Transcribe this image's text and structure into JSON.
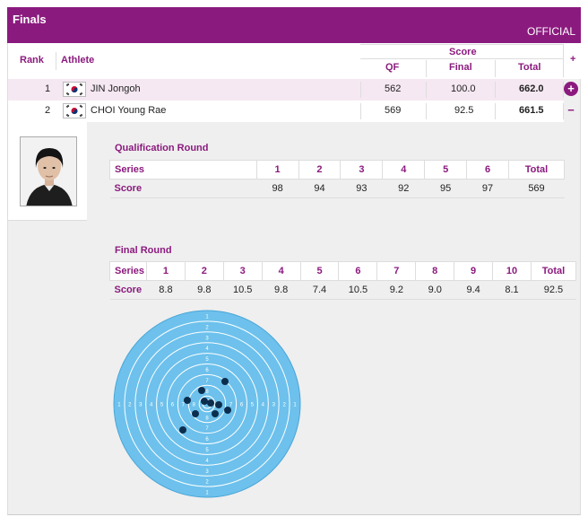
{
  "header": {
    "title": "Finals",
    "status": "OFFICIAL"
  },
  "columns": {
    "rank": "Rank",
    "athlete": "Athlete",
    "score_group": "Score",
    "qf": "QF",
    "final": "Final",
    "total": "Total",
    "expand_all": "+"
  },
  "rows": [
    {
      "rank": "1",
      "name": "JIN Jongoh",
      "qf": "562",
      "final": "100.0",
      "total": "662.0",
      "toggle": "+"
    },
    {
      "rank": "2",
      "name": "CHOI Young Rae",
      "qf": "569",
      "final": "92.5",
      "total": "661.5",
      "toggle": "−"
    }
  ],
  "qualification": {
    "title": "Qualification Round",
    "series_label": "Series",
    "score_label": "Score",
    "total_label": "Total",
    "series": [
      "1",
      "2",
      "3",
      "4",
      "5",
      "6"
    ],
    "scores": [
      "98",
      "94",
      "93",
      "92",
      "95",
      "97"
    ],
    "total": "569"
  },
  "final_round": {
    "title": "Final Round",
    "series_label": "Series",
    "score_label": "Score",
    "total_label": "Total",
    "series": [
      "1",
      "2",
      "3",
      "4",
      "5",
      "6",
      "7",
      "8",
      "9",
      "10"
    ],
    "scores": [
      "8.8",
      "9.8",
      "10.5",
      "9.8",
      "7.4",
      "10.5",
      "9.2",
      "9.0",
      "9.4",
      "8.1"
    ],
    "total": "92.5"
  },
  "target": {
    "ring_numbers": [
      "1",
      "2",
      "3",
      "4",
      "5",
      "6",
      "7",
      "8"
    ],
    "colors": {
      "ring": "#6dc1ec",
      "line": "#ffffff",
      "shot": "#0c2e4e"
    }
  },
  "colors": {
    "accent": "#8b1a7e",
    "row_highlight": "#f5e8f2",
    "panel": "#efefef"
  }
}
